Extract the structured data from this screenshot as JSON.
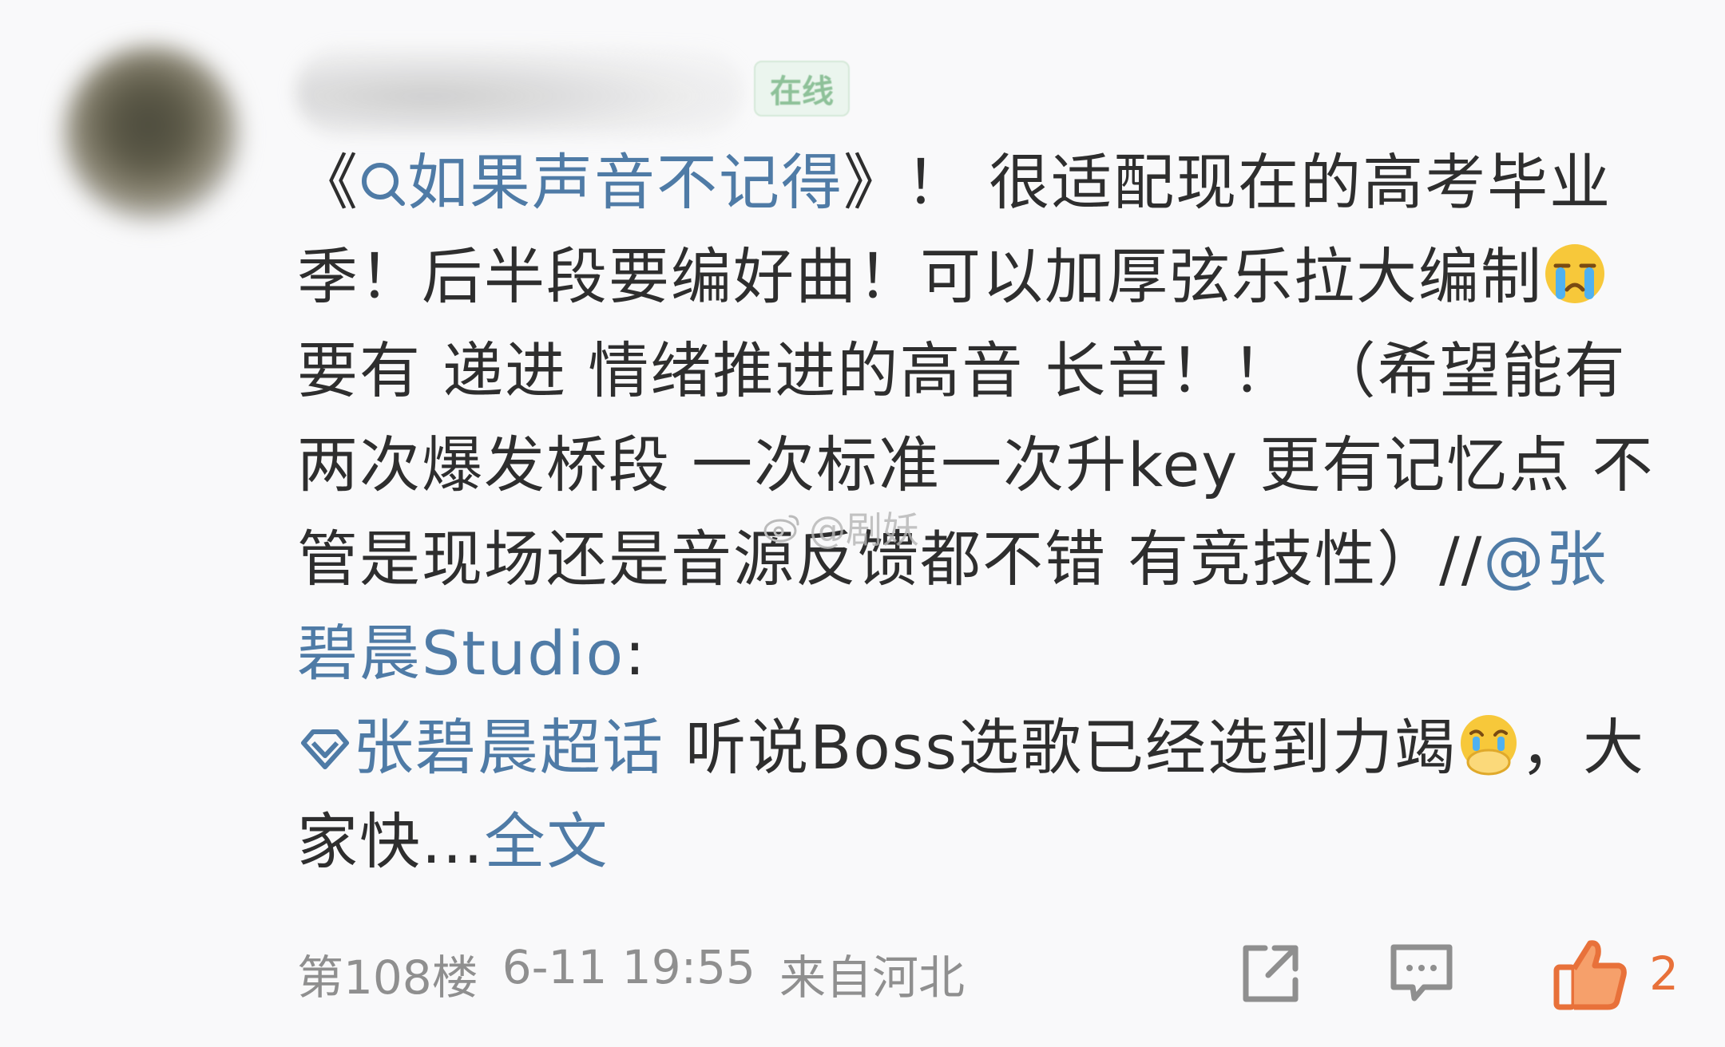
{
  "post": {
    "online_badge": "在线",
    "content": {
      "open_quote": "《",
      "topic_link": "如果声音不记得",
      "text_1": "》！ 很适配现在的高考毕业季！后半段要编好曲！可以加厚弦乐拉大编制",
      "emoji_1": "crying-face",
      "text_2": "要有 递进 情绪推进的高音 长音！！ （希望能有两次爆发桥段 一次标准一次升key 更有记忆点 不管是现场还是音源反馈都不错 有竞技性）//",
      "mention": "@张碧晨Studio",
      "text_3": ":",
      "super_topic": "张碧晨超话",
      "text_4": " 听说Boss选歌已经选到力竭",
      "emoji_2": "hands-over-mouth-face",
      "text_5": "，大家快...",
      "more_link": "全文"
    },
    "footer": {
      "floor": "第108楼",
      "time": "6-11 19:55",
      "location": "来自河北",
      "like_count": "2"
    }
  },
  "watermark": "@剧妖",
  "colors": {
    "link": "#4f7ba6",
    "like": "#e8713a",
    "meta": "#8f8f8f"
  }
}
